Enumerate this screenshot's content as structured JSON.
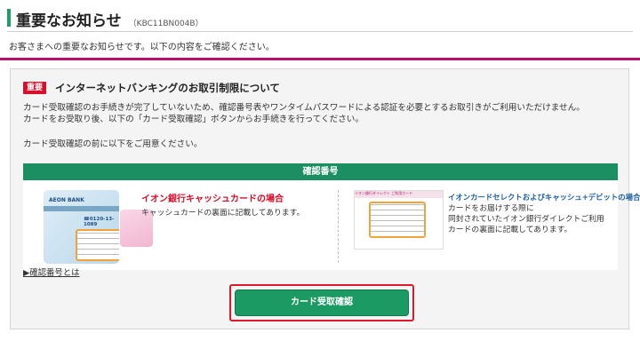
{
  "page": {
    "title": "重要なお知らせ",
    "code": "（KBC11BN004B）",
    "intro": "お客さまへの重要なお知らせです。以下の内容をご確認ください。"
  },
  "notice": {
    "badge": "重要",
    "title": "インターネットバンキングのお取引制限について",
    "paragraph1_line1": "カード受取確認のお手続きが完了していないため、確認番号表やワンタイムパスワードによる認証を必要とするお取引きがご利用いただけません。",
    "paragraph1_line2": "カードをお受取り後、以下の「カード受取確認」ボタンからお手続きを行ってください。",
    "paragraph2": "カード受取確認の前に以下をご用意ください。"
  },
  "code_box": {
    "header": "確認番号",
    "left": {
      "card_brand": "AEON BANK",
      "card_phone": "☎0120-13-1089",
      "title": "イオン銀行キャッシュカードの場合",
      "desc": "キャッシュカードの裏面に記載してあります。"
    },
    "right": {
      "card_header": "イオン銀行ダイレクト ご利用カード",
      "title": "イオンカードセレクトおよびキャッシュ+デビットの場合",
      "desc_line1": "カードをお届けする際に",
      "desc_line2": "同封されていたイオン銀行ダイレクトご利用",
      "desc_line3": "カードの裏面に記載してあります。"
    }
  },
  "link": {
    "label": "▶確認番号とは"
  },
  "button": {
    "label": "カード受取確認"
  },
  "colors": {
    "accent_green": "#1c9a64",
    "magenta": "#b5116c",
    "alert_red": "#d6102a"
  }
}
